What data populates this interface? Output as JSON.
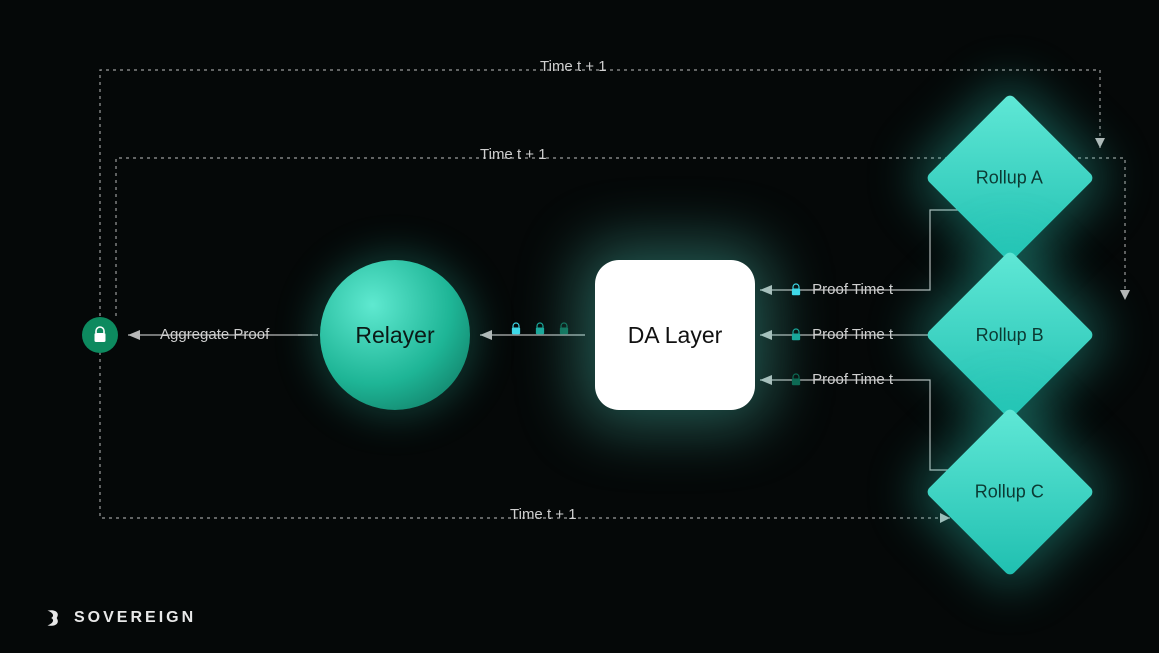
{
  "brand": "SOVEREIGN",
  "nodes": {
    "aggregate_proof_label": "Aggregate Proof",
    "relayer_label": "Relayer",
    "da_layer_label": "DA Layer",
    "rollup_a_label": "Rollup A",
    "rollup_b_label": "Rollup B",
    "rollup_c_label": "Rollup C"
  },
  "edges": {
    "proof_time_a": "Proof Time t",
    "proof_time_b": "Proof Time t",
    "proof_time_c": "Proof Time t",
    "time_tp1_top": "Time t + 1",
    "time_tp1_mid": "Time t + 1",
    "time_tp1_bot": "Time t + 1"
  },
  "colors": {
    "lock_a": "#3fd8e8",
    "lock_b": "#1aa79a",
    "lock_c": "#0d6a54",
    "aggregate_lock": "#ffffff"
  }
}
